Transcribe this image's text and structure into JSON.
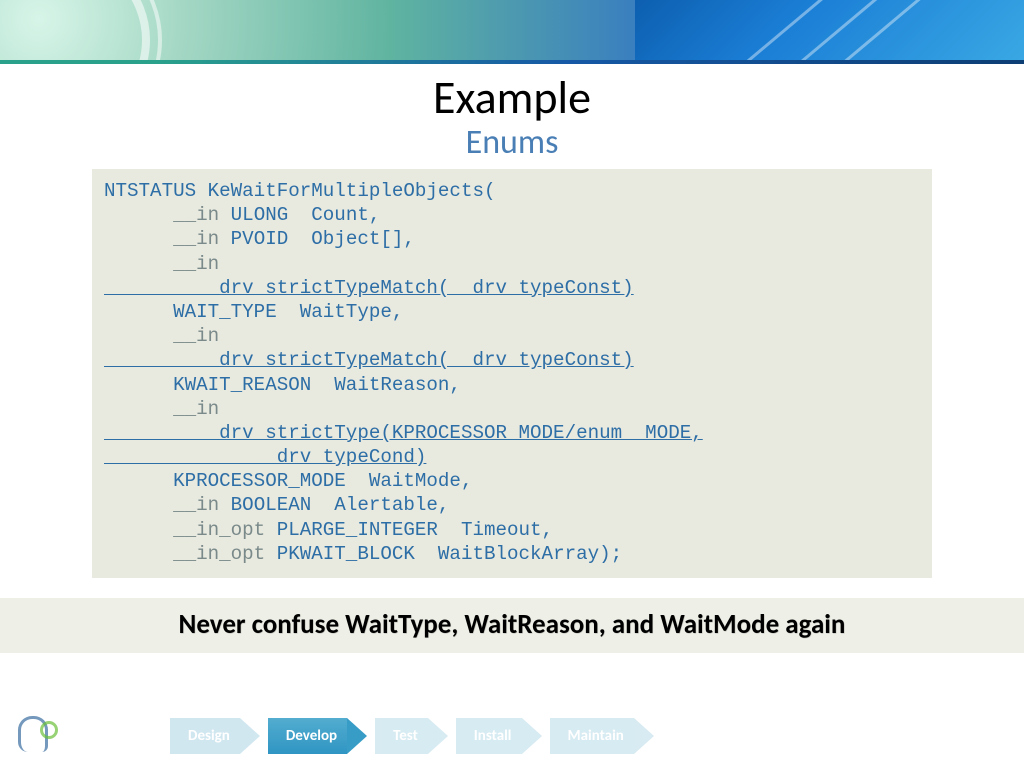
{
  "title": "Example",
  "subtitle": "Enums",
  "code": {
    "l1": "NTSTATUS KeWaitForMultipleObjects(",
    "l2a": "      __in ",
    "l2b": "ULONG  Count,",
    "l3a": "      __in ",
    "l3b": "PVOID  Object[],",
    "l4": "      __in",
    "l5": "        __drv_strictTypeMatch(__drv_typeConst)",
    "l6": "      WAIT_TYPE  WaitType,",
    "l7": "      __in",
    "l8": "        __drv_strictTypeMatch(__drv_typeConst)",
    "l9": "      KWAIT_REASON  WaitReason,",
    "l10": "      __in",
    "l11": "        __drv_strictType(KPROCESSOR_MODE/enum _MODE,",
    "l12": "             __drv_typeCond)",
    "l13": "      KPROCESSOR_MODE  WaitMode,",
    "l14a": "      __in ",
    "l14b": "BOOLEAN  Alertable,",
    "l15a": "      __in_opt ",
    "l15b": "PLARGE_INTEGER  Timeout,",
    "l16a": "      __in_opt ",
    "l16b": "PKWAIT_BLOCK  WaitBlockArray);"
  },
  "callout": "Never confuse WaitType, WaitReason, and WaitMode again",
  "footer": {
    "stages": {
      "design": "Design",
      "develop": "Develop",
      "test": "Test",
      "install": "Install",
      "maintain": "Maintain"
    }
  }
}
